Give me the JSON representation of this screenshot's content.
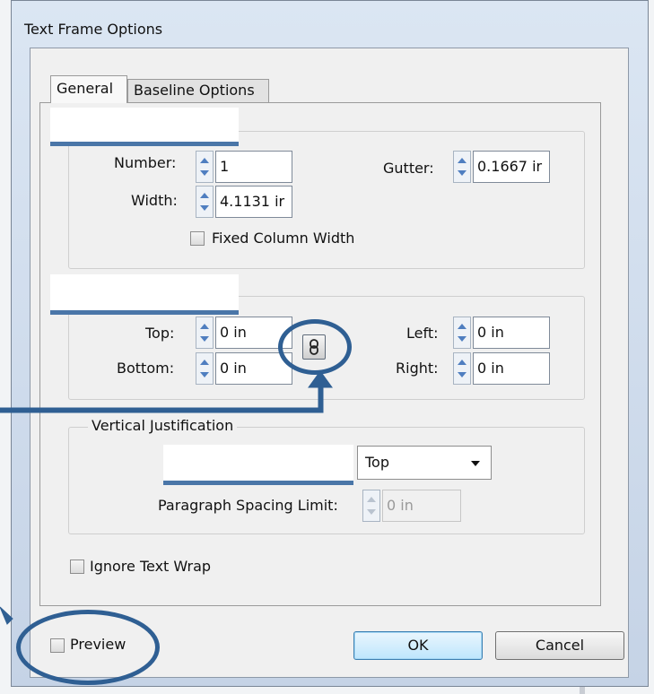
{
  "window": {
    "title": "Text Frame Options"
  },
  "tabs": [
    {
      "label": "General"
    },
    {
      "label": "Baseline Options"
    }
  ],
  "columns": {
    "number_label": "Number:",
    "number_value": "1",
    "gutter_label": "Gutter:",
    "gutter_value": "0.1667 ir",
    "width_label": "Width:",
    "width_value": "4.1131 ir",
    "fixed_column_width_label": "Fixed Column Width"
  },
  "inset": {
    "top_label": "Top:",
    "top_value": "0 in",
    "bottom_label": "Bottom:",
    "bottom_value": "0 in",
    "left_label": "Left:",
    "left_value": "0 in",
    "right_label": "Right:",
    "right_value": "0 in"
  },
  "vertical_justification": {
    "group_label": "Vertical Justification",
    "align_value": "Top",
    "paragraph_spacing_label": "Paragraph Spacing Limit:",
    "paragraph_spacing_value": "0 in"
  },
  "ignore_text_wrap_label": "Ignore Text Wrap",
  "preview_label": "Preview",
  "buttons": {
    "ok": "OK",
    "cancel": "Cancel"
  },
  "colors": {
    "annotation": "#2f5f93",
    "underline_bar": "#4a76a8",
    "dialog_frame": "#c5d3e6"
  },
  "icons": {
    "chain": "chain-link-icon",
    "dropdown": "chevron-down-icon"
  }
}
